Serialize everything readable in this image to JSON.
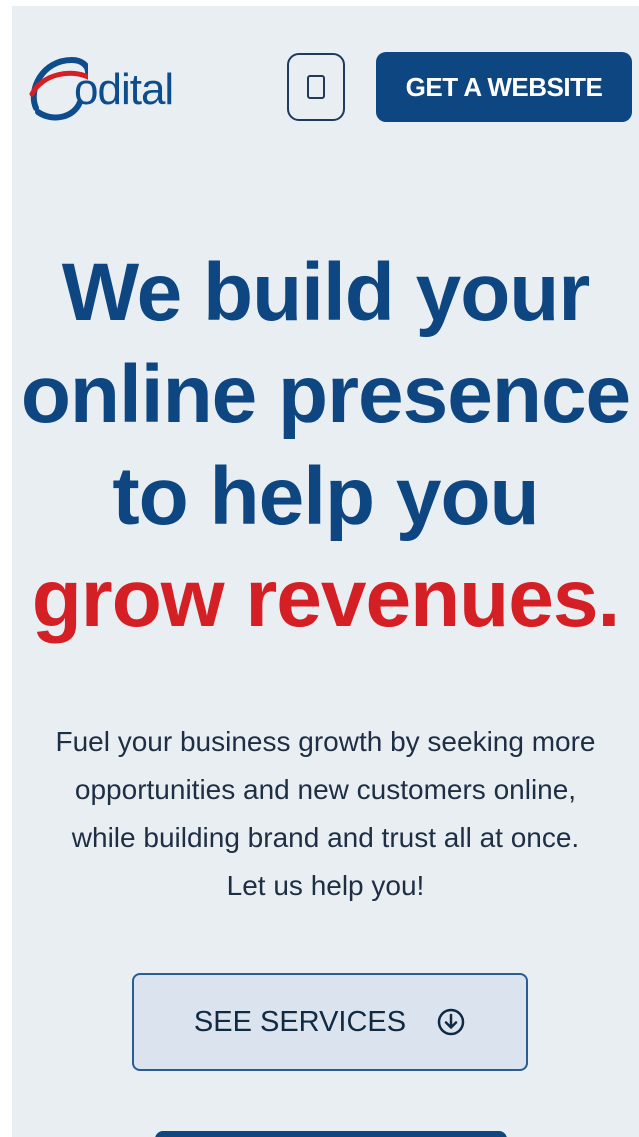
{
  "header": {
    "logo_text": "odital",
    "cta_label": "GET A WEBSITE",
    "menu_icon": "menu-toggle-icon"
  },
  "hero": {
    "headline_lines": [
      "We build your",
      "online presence",
      "to help you"
    ],
    "headline_accent": "grow revenues.",
    "subtext_lines": [
      "Fuel your business growth by seeking more",
      "opportunities and new customers online,",
      "while building brand and trust all at once.",
      "Let us help you!"
    ],
    "services_button_label": "SEE SERVICES",
    "services_button_icon": "arrow-down-circle-icon"
  },
  "colors": {
    "primary": "#0d4680",
    "accent": "#d41f24",
    "background": "#e9eef3"
  }
}
